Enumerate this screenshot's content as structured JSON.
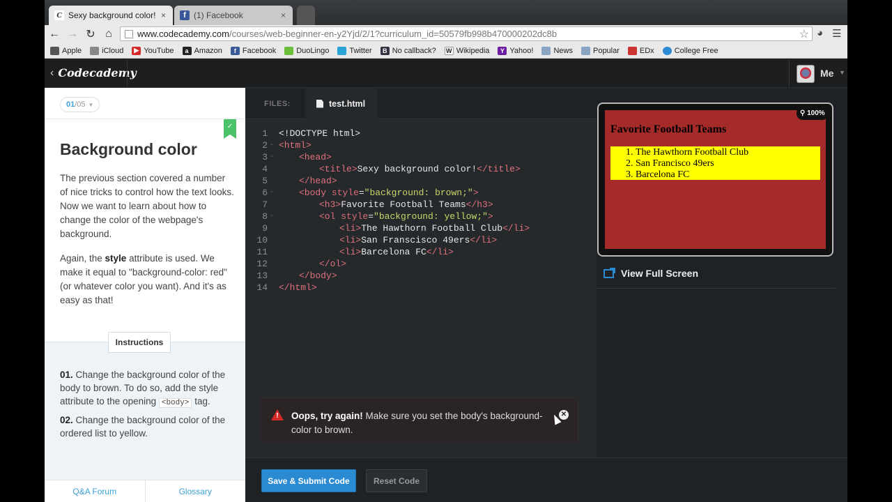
{
  "browser": {
    "tabs": [
      {
        "title": "Sexy background color! |",
        "close": "×"
      },
      {
        "title": "(1) Facebook",
        "close": "×"
      }
    ],
    "url_host": "www.codecademy.com",
    "url_path": "/courses/web-beginner-en-y2Yjd/2/1?curriculum_id=50579fb998b470000202dc8b",
    "bookmarks": [
      "Apple",
      "iCloud",
      "YouTube",
      "Amazon",
      "Facebook",
      "DuoLingo",
      "Twitter",
      "No callback?",
      "Wikipedia",
      "Yahoo!",
      "News",
      "Popular",
      "EDx",
      "College Free"
    ]
  },
  "header": {
    "logo": "Codecademy",
    "user": "Me"
  },
  "lesson": {
    "counter_current": "01",
    "counter_total": "/05",
    "title": "Background color",
    "p1": "The previous section covered a number of nice tricks to control how the text looks. Now we want to learn about how to change the color of the webpage's background.",
    "p2_a": "Again, the ",
    "p2_b": "style",
    "p2_c": " attribute is used. We make it equal to \"background-color: red\" (or whatever color you want). And it's as easy as that!",
    "instructions_tab": "Instructions",
    "i1_num": "01.",
    "i1_text": " Change the background color of the body to brown. To do so, add the style attribute to the opening ",
    "i1_code": "<body>",
    "i1_end": " tag.",
    "i2_num": "02.",
    "i2_text": " Change the background color of the ordered list to yellow.",
    "footer_qa": "Q&A Forum",
    "footer_glossary": "Glossary"
  },
  "editor": {
    "files_label": "FILES:",
    "file_name": "test.html",
    "code_lines": [
      "<!DOCTYPE html>",
      "<html>",
      "<head>",
      "<title>Sexy background color!</title>",
      "</head>",
      "<body style=\"background: brown;\">",
      "<h3>Favorite Football Teams</h3>",
      "<ol style=\"background: yellow;\">",
      "<li>The Hawthorn Football Club</li>",
      "<li>San Franscisco 49ers</li>",
      "<li>Barcelona FC</li>",
      "</ol>",
      "</body>",
      "</html>"
    ]
  },
  "error": {
    "heading": "Oops, try again!",
    "message": " Make sure you set the body's background-color to brown."
  },
  "actions": {
    "submit": "Save & Submit Code",
    "reset": "Reset Code"
  },
  "preview": {
    "zoom": "100%",
    "heading": "Favorite Football Teams",
    "items": [
      "The Hawthorn Football Club",
      "San Francisco 49ers",
      "Barcelona FC"
    ],
    "fullscreen": "View Full Screen",
    "body_color": "#a52a2a",
    "list_color": "#ffff00"
  }
}
